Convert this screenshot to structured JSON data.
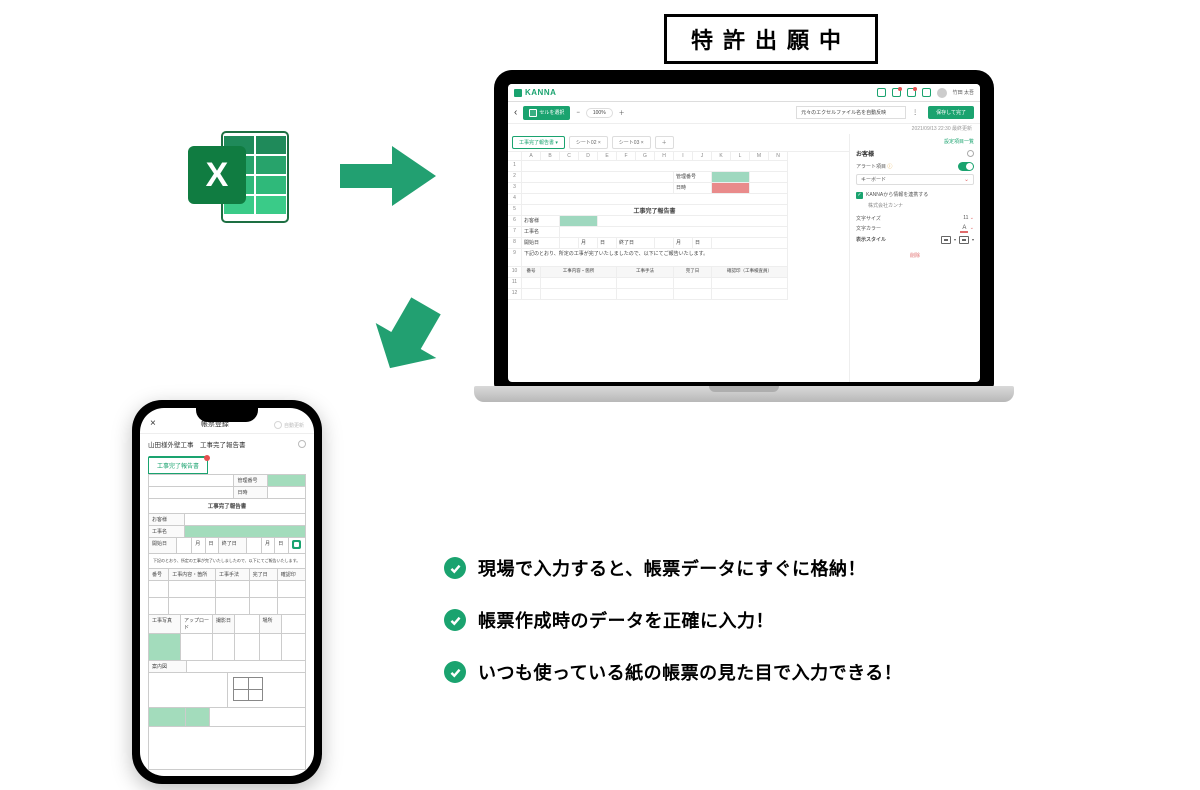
{
  "patent_badge": "特許出願中",
  "excel": {
    "letter": "X"
  },
  "laptop": {
    "brand": "KANNA",
    "username": "竹田 太吾",
    "toolbar": {
      "select_cell": "セルを選択",
      "zoom": "100%",
      "filename": "元々のエクセルファイル名を自動反映",
      "save_btn": "保存して完了"
    },
    "timestamp": "2021/09/13 22:30 最終更新",
    "tabs": [
      "工事完了報告書",
      "シート02",
      "シート03"
    ],
    "col_letters": [
      "A",
      "B",
      "C",
      "D",
      "E",
      "F",
      "G",
      "H",
      "I",
      "J",
      "K",
      "L",
      "M",
      "N"
    ],
    "row_numbers": [
      "1",
      "2",
      "3",
      "4",
      "5",
      "6",
      "7",
      "8",
      "9",
      "10",
      "11",
      "12"
    ],
    "cells": {
      "mgmt_no": "管理番号",
      "date": "日時",
      "title": "工事完了報告書",
      "customer": "お客様",
      "construction": "工事名",
      "start": "開始日",
      "end": "終了日",
      "month": "月",
      "day": "日",
      "note": "下記のとおり、所定の工事が完了いたしましたので、以下にてご報告いたします。",
      "th_no": "番号",
      "th_content": "工事内容・箇所",
      "th_method": "工事手法",
      "th_complete": "完了日",
      "th_dept": "確認印（工事検査員）"
    },
    "side": {
      "link": "設定項目一覧",
      "section": "お客様",
      "alert": "アラート項目",
      "input_type": "キーボード",
      "kanna_check": "KANNAから情報を連携する",
      "company": "株式会社カンナ",
      "font_size_lbl": "文字サイズ",
      "font_size_val": "11",
      "font_color_lbl": "文字カラー",
      "font_color_glyph": "A",
      "style_lbl": "表示スタイル",
      "delete": "削除"
    }
  },
  "phone": {
    "header_title": "帳票登録",
    "reload_label": "自動更新",
    "sub_title": "山田様外壁工事　工事完了報告書",
    "tab": "工事完了報告書",
    "form": {
      "mgmt_no": "管理番号",
      "date": "日時",
      "title": "工事完了報告書",
      "customer": "お客様",
      "construction": "工事名",
      "start": "開始日",
      "end": "終了日",
      "month": "月",
      "day": "日",
      "note": "下記のとおり、所定の工事が完了いたしましたので、以下にてご報告いたします。",
      "th_no": "番号",
      "th_content": "工事内容・箇所",
      "th_method": "工事手法",
      "th_complete": "完了日",
      "th_dept": "確認印",
      "sec_photo": "工事写真",
      "sec_photo_sub": "アップロード",
      "ph_date": "撮影日",
      "ph_place": "場所",
      "sec_plan": "案内図"
    }
  },
  "benefits": [
    "現場で入力すると、帳票データにすぐに格納！",
    "帳票作成時のデータを正確に入力！",
    "いつも使っている紙の帳票の見た目で入力できる！"
  ]
}
